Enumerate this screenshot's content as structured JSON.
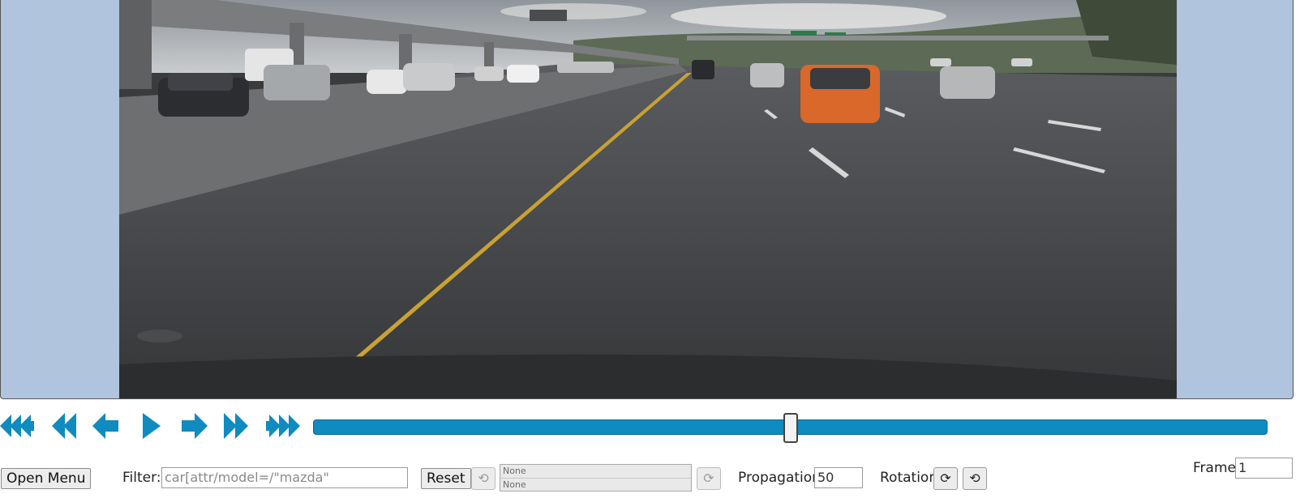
{
  "player": {
    "buttons": [
      {
        "name": "first-frame",
        "icon": "triple-left-arrow-icon"
      },
      {
        "name": "previous-chunk",
        "icon": "double-left-arrow-icon"
      },
      {
        "name": "previous-frame",
        "icon": "left-arrow-icon"
      },
      {
        "name": "play",
        "icon": "play-icon"
      },
      {
        "name": "next-frame",
        "icon": "right-arrow-icon"
      },
      {
        "name": "next-chunk",
        "icon": "double-right-arrow-icon"
      },
      {
        "name": "last-frame",
        "icon": "triple-right-arrow-icon"
      }
    ],
    "slider_position": 0.5
  },
  "bottom": {
    "open_menu_label": "Open Menu",
    "filter_label": "Filter:",
    "filter_value": "car[attr/model=/\"mazda\"",
    "reset_label": "Reset",
    "undo_icon": "undo-icon",
    "redo_icon": "redo-icon",
    "history": [
      "None",
      "None"
    ],
    "propagation_label": "Propagation",
    "propagation_value": "50",
    "rotation_label": "Rotation",
    "rotate_cw_icon": "rotate-clockwise-icon",
    "rotate_ccw_icon": "rotate-counterclockwise-icon",
    "frame_label": "Frame",
    "frame_value": "1"
  },
  "colors": {
    "accent": "#0f8bbf",
    "canvas_background": "#b0c4de"
  }
}
